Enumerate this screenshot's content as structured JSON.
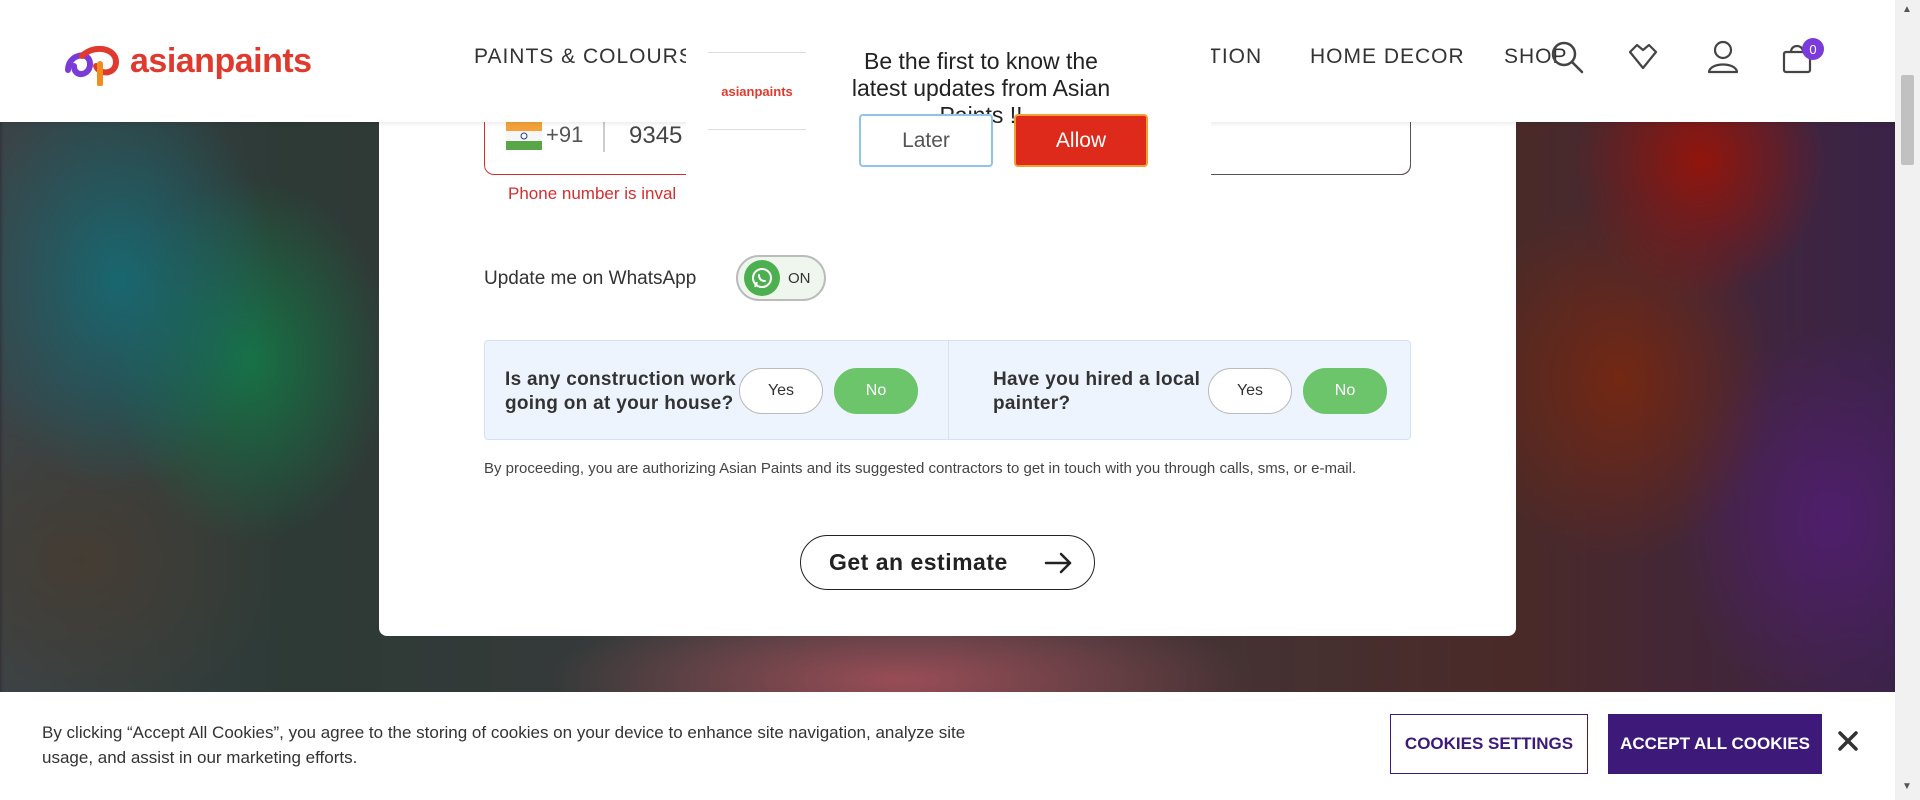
{
  "header": {
    "logo_text": "asianpaints",
    "nav": [
      "PAINTS & COLOURS",
      "TION",
      "HOME DECOR",
      "SHOP"
    ],
    "cart_count": "0"
  },
  "notification": {
    "logo_text": "asianpaints",
    "message": "Be the first to know the latest updates from Asian Paints !!",
    "later_label": "Later",
    "allow_label": "Allow"
  },
  "form": {
    "country_code": "+91",
    "phone_value": "9345",
    "phone_error": "Phone number is inval",
    "whatsapp_label": "Update me on WhatsApp",
    "whatsapp_state": "ON",
    "q1": {
      "text": "Is any construction work going on at your house?",
      "yes": "Yes",
      "no": "No",
      "selected": "No"
    },
    "q2": {
      "text": "Have you hired a local painter?",
      "yes": "Yes",
      "no": "No",
      "selected": "No"
    },
    "consent": "By proceeding, you are authorizing Asian Paints and its suggested contractors to get in touch with you through calls, sms, or e-mail.",
    "submit_label": "Get an estimate"
  },
  "cookies": {
    "text": "By clicking “Accept All Cookies”, you agree to the storing of cookies on your device to enhance site navigation, analyze site usage, and assist in our marketing efforts.",
    "settings_label": "COOKIES SETTINGS",
    "accept_label": "ACCEPT ALL COOKIES"
  },
  "colors": {
    "brand_red": "#e03a2f",
    "error_red": "#d32f2f",
    "toggle_green": "#6cc46b",
    "cookie_purple": "#3d1a7a",
    "badge_purple": "#7a3bd9"
  }
}
